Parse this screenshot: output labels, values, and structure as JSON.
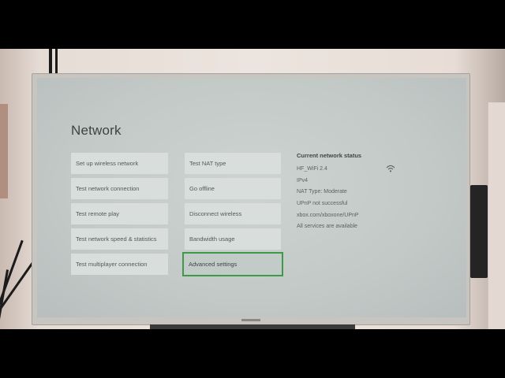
{
  "page": {
    "title": "Network"
  },
  "actions_left": [
    {
      "label": "Set up wireless network"
    },
    {
      "label": "Test network connection"
    },
    {
      "label": "Test remote play"
    },
    {
      "label": "Test network speed & statistics"
    },
    {
      "label": "Test multiplayer connection"
    }
  ],
  "actions_right": [
    {
      "label": "Test NAT type"
    },
    {
      "label": "Go offline"
    },
    {
      "label": "Disconnect wireless"
    },
    {
      "label": "Bandwidth usage"
    },
    {
      "label": "Advanced settings",
      "focused": true
    }
  ],
  "status": {
    "title": "Current network status",
    "network_name": "HF_WiFi 2.4",
    "ip_version": "IPv4",
    "nat_type": "NAT Type: Moderate",
    "upnp": "UPnP not successful",
    "upnp_link": "xbox.com/xboxone/UPnP",
    "services": "All services are available",
    "wifi_icon": "wifi-signal-icon"
  },
  "colors": {
    "focus_border": "#3d9a47",
    "screen_bg": "#c2c9c7",
    "tile_bg": "#d9dedc"
  }
}
